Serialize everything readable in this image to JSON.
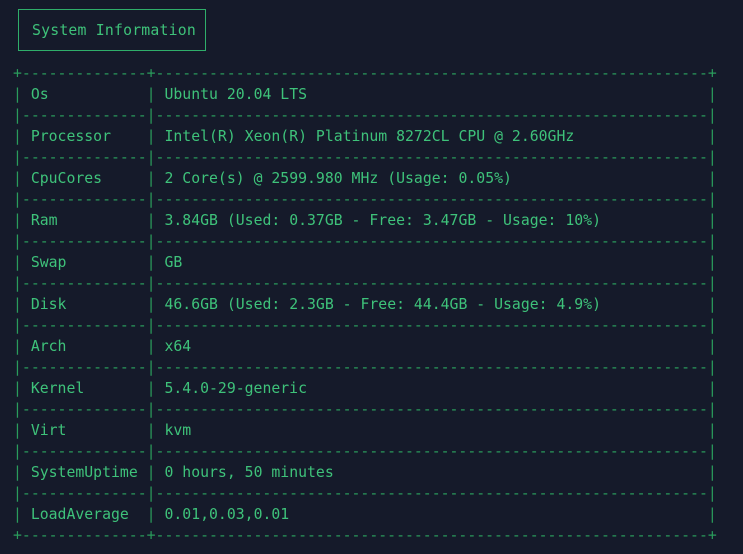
{
  "title": "System Information",
  "rows": [
    {
      "key": "Os",
      "value": "Ubuntu 20.04 LTS"
    },
    {
      "key": "Processor",
      "value": "Intel(R) Xeon(R) Platinum 8272CL CPU @ 2.60GHz"
    },
    {
      "key": "CpuCores",
      "value": "2 Core(s) @ 2599.980 MHz (Usage: 0.05%)"
    },
    {
      "key": "Ram",
      "value": "3.84GB (Used: 0.37GB - Free: 3.47GB - Usage: 10%)"
    },
    {
      "key": "Swap",
      "value": "GB"
    },
    {
      "key": "Disk",
      "value": "46.6GB (Used: 2.3GB - Free: 44.4GB - Usage: 4.9%)"
    },
    {
      "key": "Arch",
      "value": "x64"
    },
    {
      "key": "Kernel",
      "value": "5.4.0-29-generic"
    },
    {
      "key": "Virt",
      "value": "kvm"
    },
    {
      "key": "SystemUptime",
      "value": "0 hours, 50 minutes"
    },
    {
      "key": "LoadAverage",
      "value": "0.01,0.03,0.01"
    }
  ]
}
